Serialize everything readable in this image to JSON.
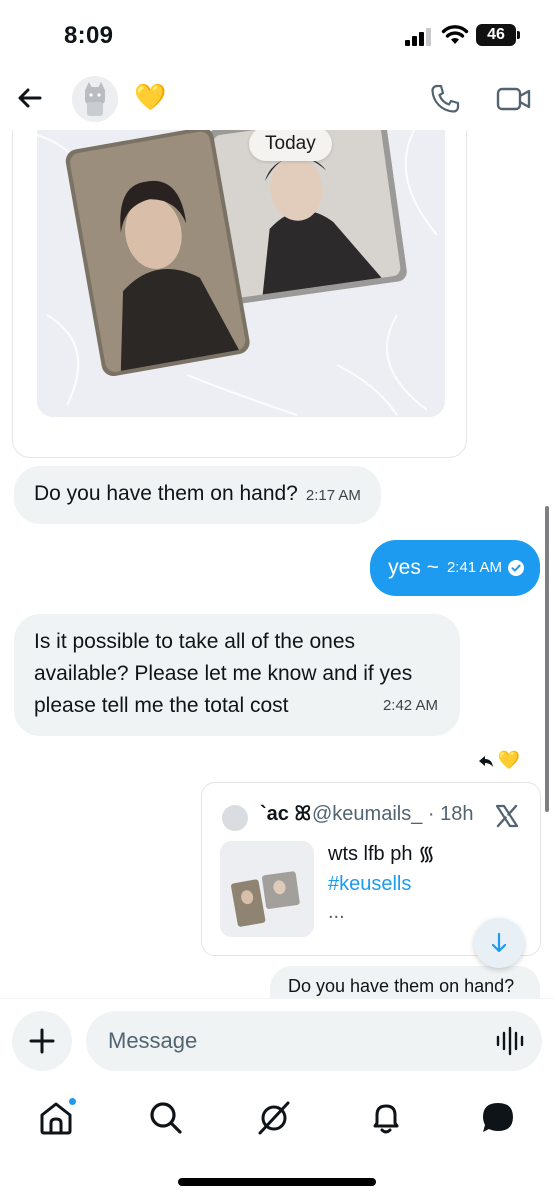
{
  "status_bar": {
    "time": "8:09",
    "battery": "46"
  },
  "header": {
    "emoji": "💛"
  },
  "chat": {
    "date_pill": "Today",
    "messages": [
      {
        "text": "Do you have them on hand?",
        "time": "2:17 AM"
      },
      {
        "text": "yes ~",
        "time": "2:41 AM"
      },
      {
        "text": "Is it possible to take all of the ones available? Please let me know and if yes please tell me the total cost",
        "time": "2:42 AM"
      }
    ],
    "reaction_emoji": "💛",
    "quote": {
      "name": "`ac ꕤ",
      "handle": "@keumails_ · 18h",
      "text": "wts lfb ph ᯾",
      "hashtag": "#keusells",
      "more": "..."
    },
    "partial_reply": "Do you have them on hand?"
  },
  "composer": {
    "placeholder": "Message"
  },
  "colors": {
    "accent": "#1d9bf0",
    "bubble_in": "#eff3f4"
  },
  "icons": [
    "back-arrow-icon",
    "phone-icon",
    "video-icon",
    "plus-icon",
    "voice-wave-icon",
    "home-icon",
    "search-icon",
    "grok-icon",
    "bell-icon",
    "messages-icon"
  ]
}
